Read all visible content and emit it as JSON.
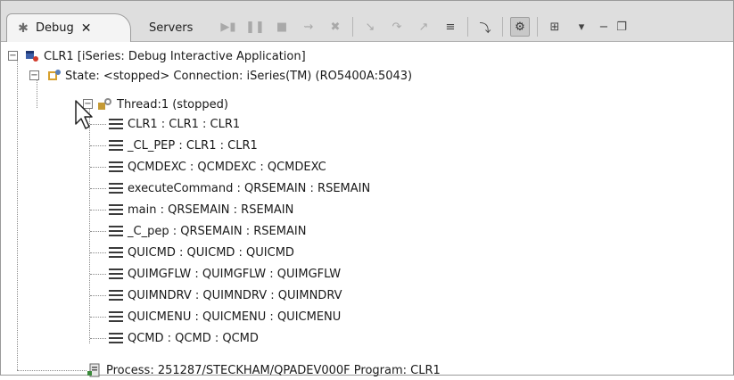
{
  "tabs": [
    {
      "label": "Debug",
      "close": "✕",
      "icon": "debug-bug-icon"
    },
    {
      "label": "Servers"
    }
  ],
  "toolbar": {
    "icons": [
      "resume-icon",
      "suspend-icon",
      "terminate-icon",
      "disconnect-icon",
      "remove-terminated-icon",
      "step-into-icon",
      "step-over-icon",
      "step-return-icon",
      "drop-to-frame-icon",
      "step-filters-icon",
      "show-system-threads-icon",
      "tree-layout-icon",
      "view-menu-chevron-icon",
      "minimize-icon",
      "maximize-icon"
    ]
  },
  "tree": {
    "root": "CLR1 [iSeries: Debug Interactive Application]",
    "state": "State: <stopped> Connection: iSeries(TM) (RO5400A:5043)",
    "thread": "Thread:1 (stopped)",
    "frames": [
      "CLR1 : CLR1 : CLR1",
      "_CL_PEP : CLR1 : CLR1",
      "QCMDEXC : QCMDEXC : QCMDEXC",
      "executeCommand : QRSEMAIN : RSEMAIN",
      "main : QRSEMAIN : RSEMAIN",
      "_C_pep : QRSEMAIN : RSEMAIN",
      "QUICMD : QUICMD : QUICMD",
      "QUIMGFLW : QUIMGFLW : QUIMGFLW",
      "QUIMNDRV : QUIMNDRV : QUIMNDRV",
      "QUICMENU : QUICMENU : QUICMENU",
      "QCMD : QCMD : QCMD"
    ],
    "process": "Process: 251287/STECKHAM/QPADEV000F  Program: CLR1"
  }
}
